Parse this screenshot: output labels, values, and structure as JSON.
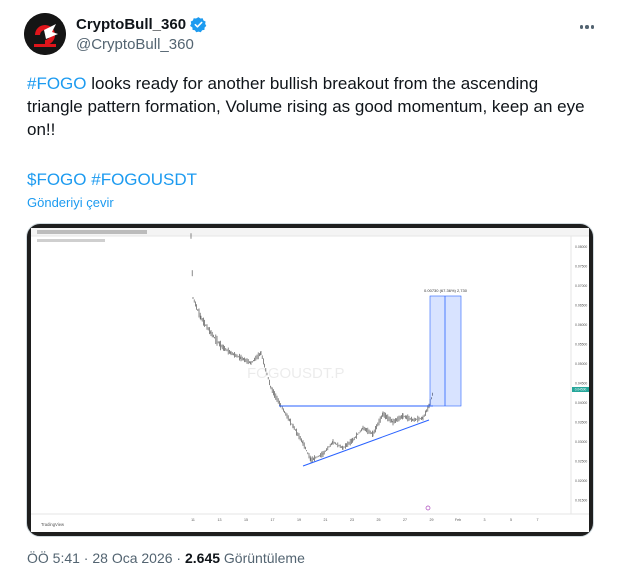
{
  "author": {
    "display_name": "CryptoBull_360",
    "handle": "@CryptoBull_360",
    "verified": true,
    "avatar_icon": "bull-logo-avatar",
    "verified_color": "#1d9bf0"
  },
  "post": {
    "text_hashtag": "#FOGO",
    "text_body": " looks ready for another bullish breakout from the ascending triangle pattern formation, Volume rising as good momentum, keep an eye on!!",
    "tag_cashtag": "$FOGO",
    "tag_hashtag": "#FOGOUSDT",
    "translate_label": "Gönderiyi çevir"
  },
  "chart": {
    "watermark": "FOGOUSDT.P",
    "target_label": "0.00730 (67.36%) 2,730",
    "brand": "TradingView",
    "x_ticks": [
      "11",
      "13",
      "15",
      "17",
      "19",
      "21",
      "23",
      "25",
      "27",
      "29",
      "Feb",
      "3",
      "5",
      "7"
    ],
    "y_ticks": [
      "0.08000",
      "0.07500",
      "0.07000",
      "0.06500",
      "0.06000",
      "0.05500",
      "0.05000",
      "0.04500",
      "0.04000",
      "0.03500",
      "0.03000",
      "0.02500",
      "0.02000",
      "0.01500"
    ],
    "price_tag": "0.04500",
    "colors": {
      "trend_line": "#2962ff",
      "target_box": "#2962ff",
      "candles": "#555555"
    }
  },
  "footer": {
    "time_date": "ÖÖ 5:41 · 28 Oca 2026 · ",
    "views_count": "2.645",
    "views_label": " Görüntüleme"
  }
}
